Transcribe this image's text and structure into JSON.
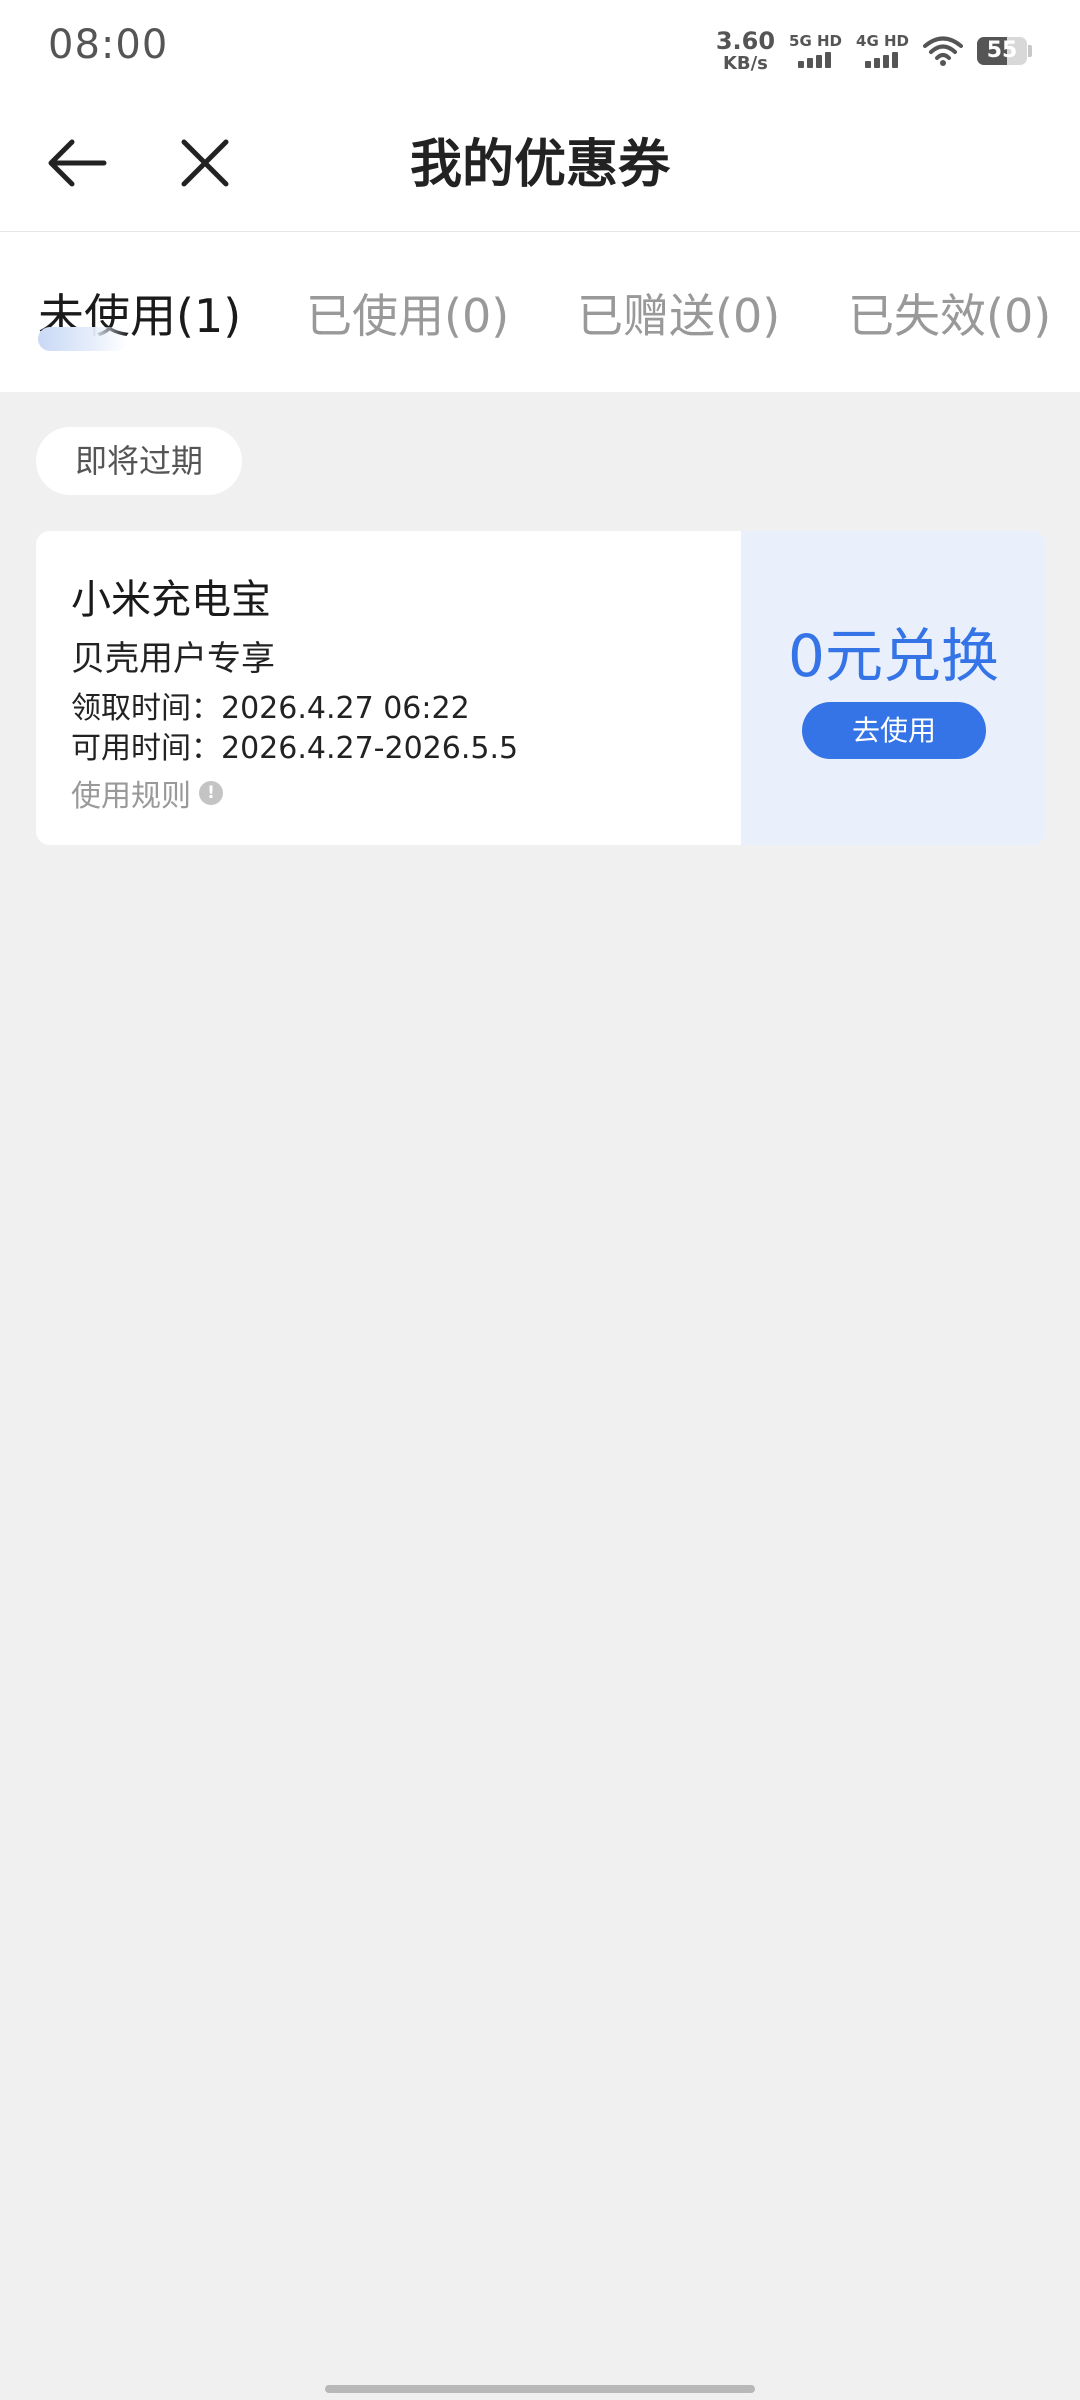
{
  "status_bar": {
    "time": "08:00",
    "net_speed_value": "3.60",
    "net_speed_unit": "KB/s",
    "sim1_label": "5G HD",
    "sim2_label": "4G HD",
    "battery_level": "55",
    "icons": [
      "signal-icon",
      "wifi-icon",
      "battery-icon"
    ]
  },
  "nav": {
    "title": "我的优惠券",
    "back_icon": "arrow-left-icon",
    "close_icon": "close-icon"
  },
  "tabs": [
    {
      "label": "未使用(1)",
      "active": true
    },
    {
      "label": "已使用(0)",
      "active": false
    },
    {
      "label": "已赠送(0)",
      "active": false
    },
    {
      "label": "已失效(0)",
      "active": false
    }
  ],
  "content": {
    "section_badge": "即将过期",
    "coupon": {
      "name": "小米充电宝",
      "subtitle": "贝壳用户专享",
      "claim_time": "领取时间：2026.4.27 06:22",
      "valid_time": "可用时间：2026.4.27-2026.5.5",
      "rules_label": "使用规则",
      "rules_icon_glyph": "!",
      "value": "0元兑换",
      "action_label": "去使用"
    }
  },
  "colors": {
    "accent": "#3574e6",
    "coupon_right_bg": "#e9f0fc",
    "page_bg": "#f0f0f0"
  }
}
